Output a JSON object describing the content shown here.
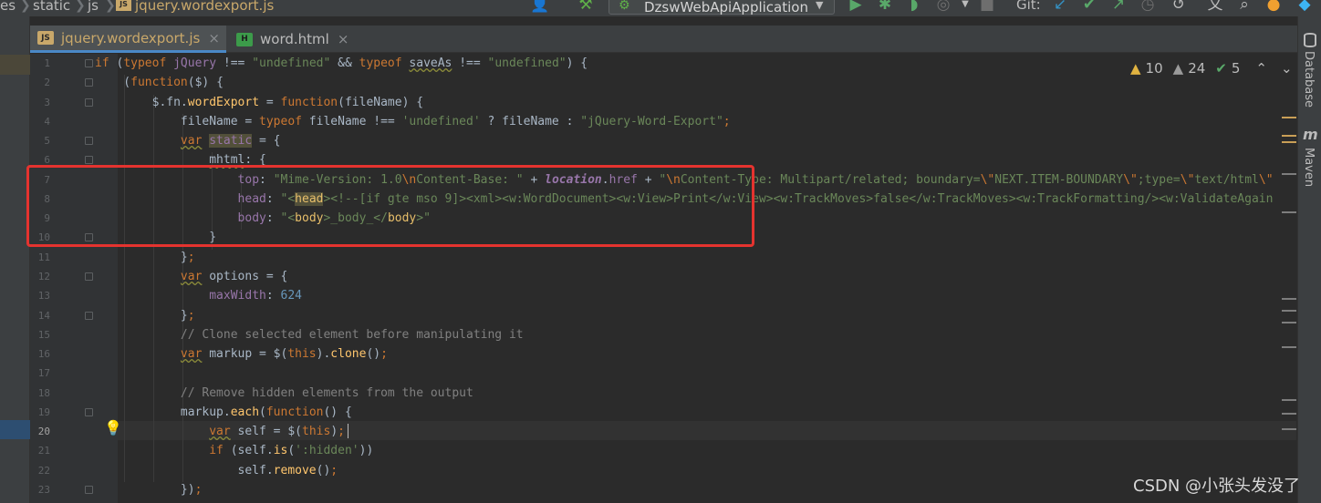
{
  "breadcrumb": {
    "items": [
      "es",
      "static",
      "js",
      "jquery.wordexport.js"
    ],
    "file_badge": "JS"
  },
  "run_config": {
    "label": "DzswWebApiApplication"
  },
  "git": {
    "label": "Git:"
  },
  "tabs": [
    {
      "label": "jquery.wordexport.js",
      "badge": "JS",
      "active": true
    },
    {
      "label": "word.html",
      "badge": "H",
      "active": false
    }
  ],
  "inspections": {
    "warnings": "10",
    "weak_warnings": "24",
    "ok": "5"
  },
  "right_panel": {
    "database": "Database",
    "maven_icon": "m",
    "maven": "Maven"
  },
  "watermark": "CSDN @小张头发没了",
  "gutter": {
    "line_numbers": [
      "1",
      "2",
      "3",
      "4",
      "5",
      "6",
      "7",
      "8",
      "9",
      "10",
      "11",
      "12",
      "13",
      "14",
      "15",
      "16",
      "17",
      "18",
      "19",
      "20",
      "21",
      "22",
      "23"
    ],
    "current_line": "20"
  },
  "code_lines": [
    "if (typeof jQuery !== \"undefined\" && typeof saveAs !== \"undefined\") {",
    "    (function($) {",
    "        $.fn.wordExport = function(fileName) {",
    "            fileName = typeof fileName !== 'undefined' ? fileName : \"jQuery-Word-Export\";",
    "            var static = {",
    "                mhtml: {",
    "                    top: \"Mime-Version: 1.0\\nContent-Base: \" + location.href + \"\\nContent-Type: Multipart/related; boundary=\\\"NEXT.ITEM-BOUNDARY\\\";type=\\\"text/html\\\"",
    "                    head: \"<head><!--[if gte mso 9]><xml><w:WordDocument><w:View>Print</w:View><w:TrackMoves>false</w:TrackMoves><w:TrackFormatting/><w:ValidateAgain",
    "                    body: \"<body>_body_</body>\"",
    "                }",
    "            };",
    "            var options = {",
    "                maxWidth: 624",
    "            };",
    "            // Clone selected element before manipulating it",
    "            var markup = $(this).clone();",
    "",
    "            // Remove hidden elements from the output",
    "            markup.each(function() {",
    "                var self = $(this);",
    "                if (self.is(':hidden'))",
    "                    self.remove();",
    "            });"
  ]
}
